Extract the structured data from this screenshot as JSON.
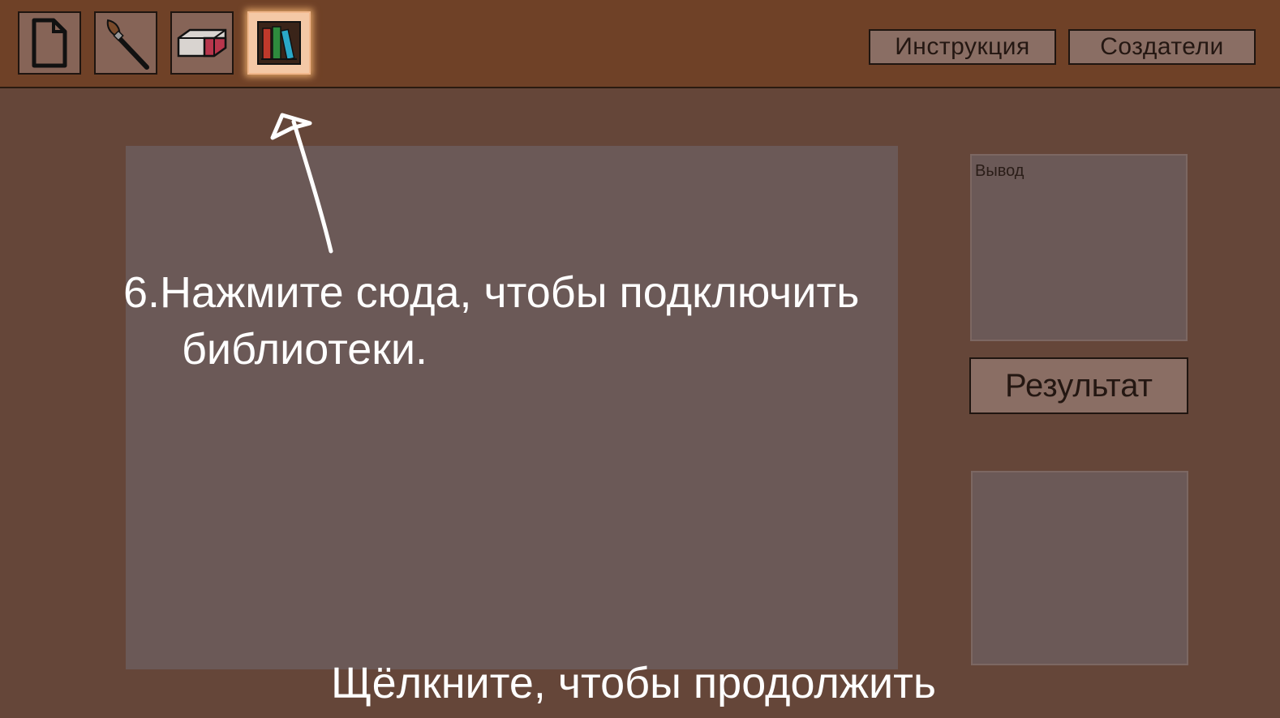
{
  "toolbar": {
    "tools": [
      {
        "name": "new-file",
        "icon": "document-icon",
        "active": false
      },
      {
        "name": "brush",
        "icon": "brush-icon",
        "active": false
      },
      {
        "name": "eraser",
        "icon": "eraser-icon",
        "active": false
      },
      {
        "name": "libraries",
        "icon": "books-icon",
        "active": true
      }
    ],
    "instruction_label": "Инструкция",
    "creators_label": "Создатели"
  },
  "output": {
    "label": "Вывод"
  },
  "result": {
    "button_label": "Результат"
  },
  "tutorial": {
    "step_line1": "6.Нажмите сюда, чтобы подключить",
    "step_line2": "библиотеки.",
    "continue_text": "Щёлкните, чтобы продолжить"
  },
  "colors": {
    "background": "#654639",
    "toolbar": "#6f4127",
    "panel": "#6b5957",
    "button": "#8a6e64",
    "highlight": "#f4c8a6",
    "overlay_text": "#ffffff"
  }
}
